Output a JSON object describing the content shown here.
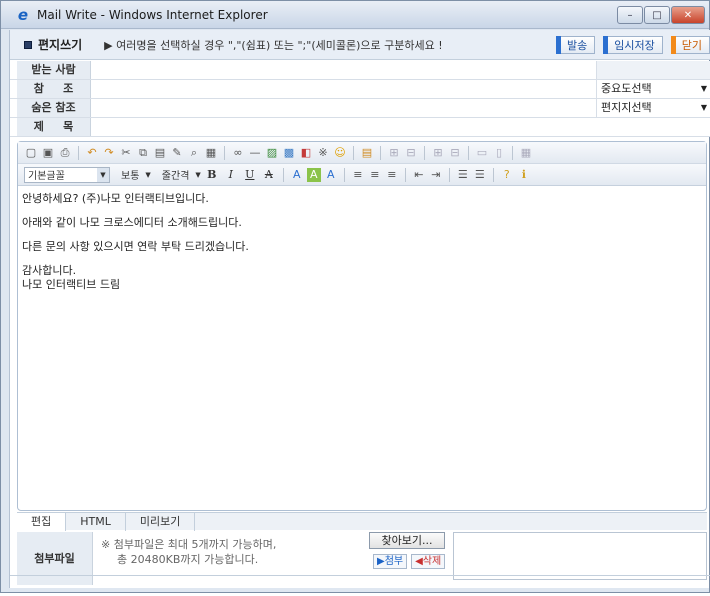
{
  "window": {
    "title": "Mail Write - Windows Internet Explorer",
    "buttons": [
      "–",
      "□",
      "✕"
    ]
  },
  "header": {
    "title": "편지쓰기",
    "message": "▶ 여러명을 선택하실 경우 \",\"(쉼표) 또는 \";\"(세미콜론)으로 구분하세요 !",
    "send_label": "발송",
    "save_draft_label": "임시저장",
    "close_label": "닫기"
  },
  "fields": {
    "to_label": "받는 사람",
    "cc_label": "참     조",
    "bcc_label": "숨은 참조",
    "subject_label": "제     목",
    "importance_select": "중요도선택",
    "stationery_select": "편지지선택"
  },
  "toolbar": {
    "font_family": "기본글꼴",
    "font_size": "보통",
    "line_spacing": "줄간격",
    "bold": "B",
    "italic": "I",
    "underline": "U",
    "strike": "A"
  },
  "body": {
    "lines": [
      "안녕하세요? (주)나모 인터랙티브입니다.",
      "아래와 같이 나모 크로스에디터 소개해드립니다.",
      "다른 문의 사항 있으시면 연락 부탁 드리겠습니다.",
      "감사합니다.",
      "나모 인터랙티브 드림"
    ]
  },
  "tabs": [
    "편집",
    "HTML",
    "미리보기"
  ],
  "attachment": {
    "label": "첨부파일",
    "browse_label": "찾아보기...",
    "note_line1": "※ 첨부파일은 최대 5개까지 가능하며,",
    "note_line2": "총 20480KB까지 가능합니다.",
    "attach_button": "▶첨부",
    "delete_button": "◀삭제"
  },
  "colors": {
    "accent_blue": "#2b6fd0",
    "accent_orange": "#f28a1a"
  }
}
